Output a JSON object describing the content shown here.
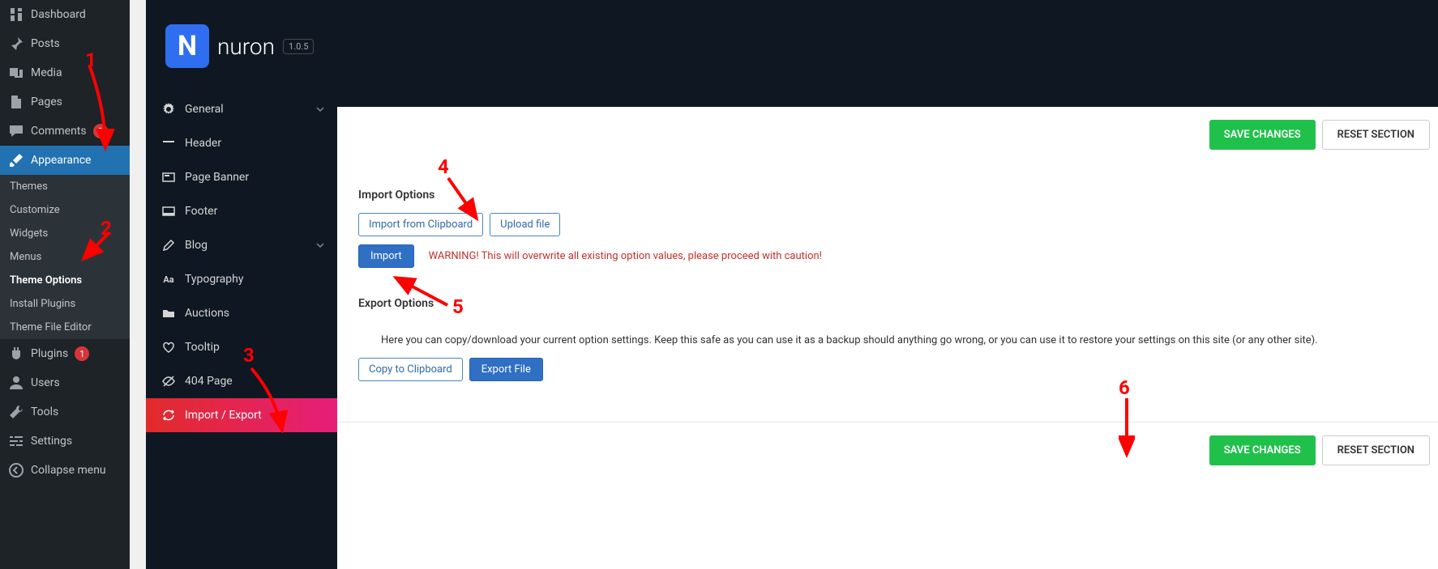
{
  "wp_sidebar": {
    "dashboard": "Dashboard",
    "posts": "Posts",
    "media": "Media",
    "pages": "Pages",
    "comments": "Comments",
    "comments_count": "3",
    "appearance": "Appearance",
    "themes": "Themes",
    "customize": "Customize",
    "widgets": "Widgets",
    "menus": "Menus",
    "theme_options": "Theme Options",
    "install_plugins": "Install Plugins",
    "theme_file_editor": "Theme File Editor",
    "plugins": "Plugins",
    "plugins_count": "1",
    "users": "Users",
    "tools": "Tools",
    "settings": "Settings",
    "collapse": "Collapse menu"
  },
  "theme": {
    "logo": "N",
    "name": "nuron",
    "version": "1.0.5",
    "nav": {
      "general": "General",
      "header": "Header",
      "page_banner": "Page Banner",
      "footer": "Footer",
      "blog": "Blog",
      "typography": "Typography",
      "auctions": "Auctions",
      "tooltip": "Tooltip",
      "p404": "404 Page",
      "import_export": "Import / Export"
    }
  },
  "content": {
    "save": "SAVE CHANGES",
    "reset": "RESET SECTION",
    "import_label": "Import Options",
    "import_clipboard": "Import from Clipboard",
    "upload_file": "Upload file",
    "import_btn": "Import",
    "warning": "WARNING! This will overwrite all existing option values, please proceed with caution!",
    "export_label": "Export Options",
    "export_desc": "Here you can copy/download your current option settings. Keep this safe as you can use it as a backup should anything go wrong, or you can use it to restore your settings on this site (or any other site).",
    "copy_clipboard": "Copy to Clipboard",
    "export_file": "Export File"
  },
  "annotations": {
    "a1": "1",
    "a2": "2",
    "a3": "3",
    "a4": "4",
    "a5": "5",
    "a6": "6"
  }
}
